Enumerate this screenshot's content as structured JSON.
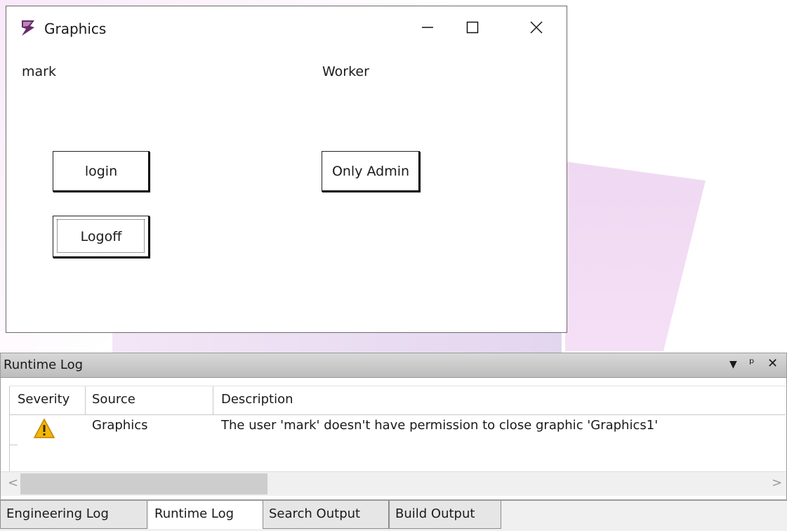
{
  "window": {
    "title": "Graphics",
    "user_label": "mark",
    "role_label": "Worker",
    "buttons": {
      "login": "login",
      "only_admin": "Only Admin",
      "logoff": "Logoff"
    }
  },
  "runtime_log": {
    "title": "Runtime Log",
    "columns": [
      "Severity",
      "Source",
      "Description"
    ],
    "rows": [
      {
        "severity": "warning",
        "source": "Graphics",
        "description": "The user 'mark' doesn't have permission to close graphic 'Graphics1'"
      }
    ]
  },
  "tabs": [
    "Engineering Log",
    "Runtime Log",
    "Search Output",
    "Build Output"
  ],
  "active_tab": "Runtime Log",
  "colors": {
    "warning": "#f2b705",
    "app_icon": "#6a2a6a"
  }
}
